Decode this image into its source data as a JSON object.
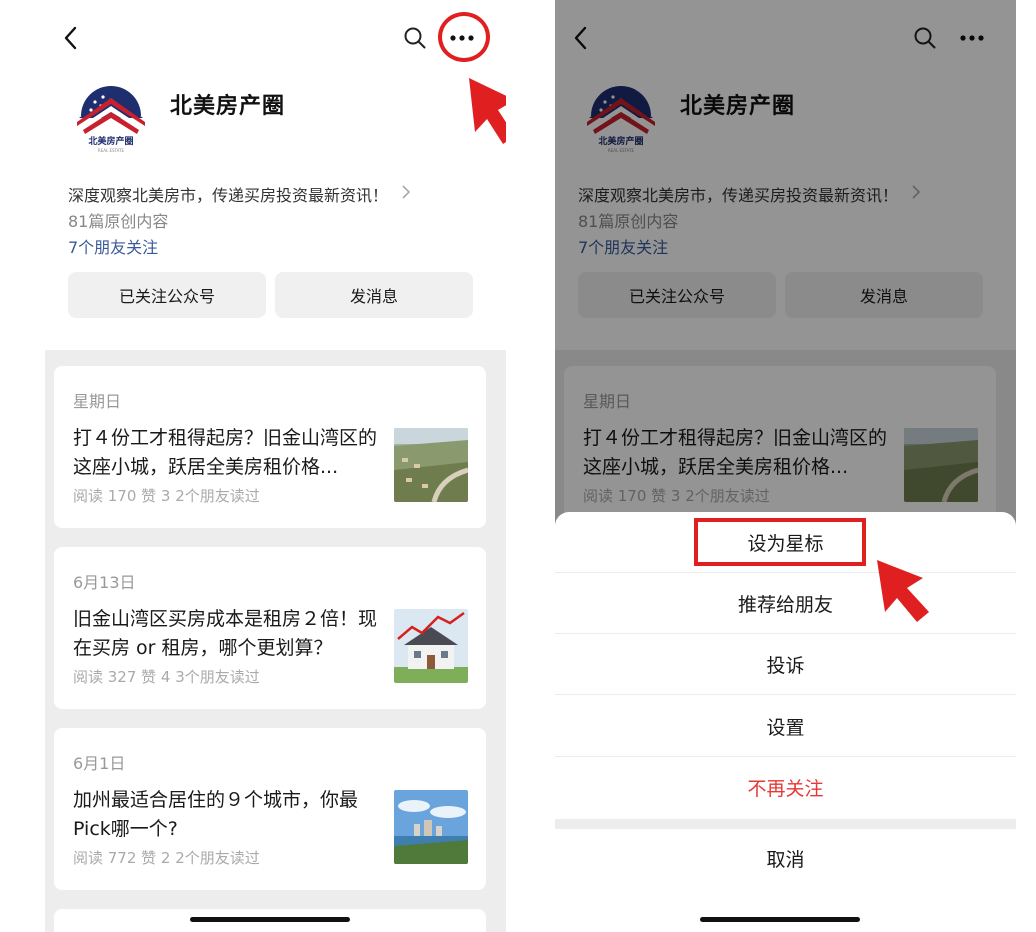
{
  "account": {
    "name": "北美房产圈",
    "logo_text": "北美房产圈",
    "logo_subtext": "REAL ESTATE",
    "description": "深度观察北美房市，传递买房投资最新资讯！",
    "original_count": "81篇原创内容",
    "friends_following": "7个朋友关注",
    "follow_button": "已关注公众号",
    "message_button": "发消息"
  },
  "icons": {
    "back": "chevron-left-icon",
    "search": "search-icon",
    "more": "more-dots-icon",
    "chevron": "chevron-right-icon"
  },
  "articles": [
    {
      "date": "星期日",
      "title": "打４份工才租得起房？旧金山湾区的这座小城，跃居全美房租价格...",
      "stats": "阅读 170  赞 3  2个朋友读过",
      "thumb": "aerial-town-photo"
    },
    {
      "date": "6月13日",
      "title": "旧金山湾区买房成本是租房２倍！现在买房 or 租房，哪个更划算？",
      "stats": "阅读 327  赞 4  3个朋友读过",
      "thumb": "house-rising-chart-photo"
    },
    {
      "date": "6月1日",
      "title": "加州最适合居住的９个城市，你最Pick哪一个?",
      "stats": "阅读 772  赞 2  2个朋友读过",
      "thumb": "city-waterfront-photo"
    }
  ],
  "action_sheet": {
    "items": [
      {
        "label": "设为星标"
      },
      {
        "label": "推荐给朋友"
      },
      {
        "label": "投诉"
      },
      {
        "label": "设置"
      },
      {
        "label": "不再关注"
      }
    ],
    "cancel": "取消"
  },
  "colors": {
    "highlight": "#e02020",
    "link_blue": "#3a5a9a",
    "danger_red": "#e53935",
    "overlay": "rgba(0,0,0,0.42)"
  }
}
